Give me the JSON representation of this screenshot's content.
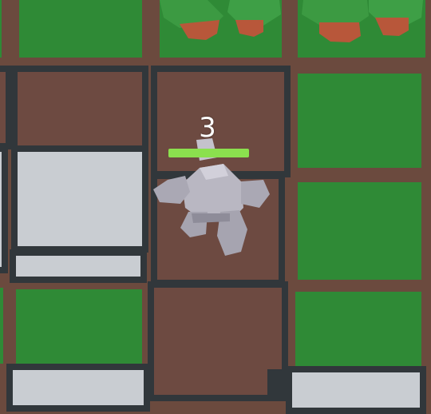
{
  "unit": {
    "level": "3",
    "health_fraction": 1.0,
    "health_color": "#8be04e"
  },
  "terrain": {
    "grass_color": "#2f8a36",
    "dirt_color": "#6d4a41",
    "stone_color": "#c9cdd2",
    "wall_color": "#31373b"
  }
}
